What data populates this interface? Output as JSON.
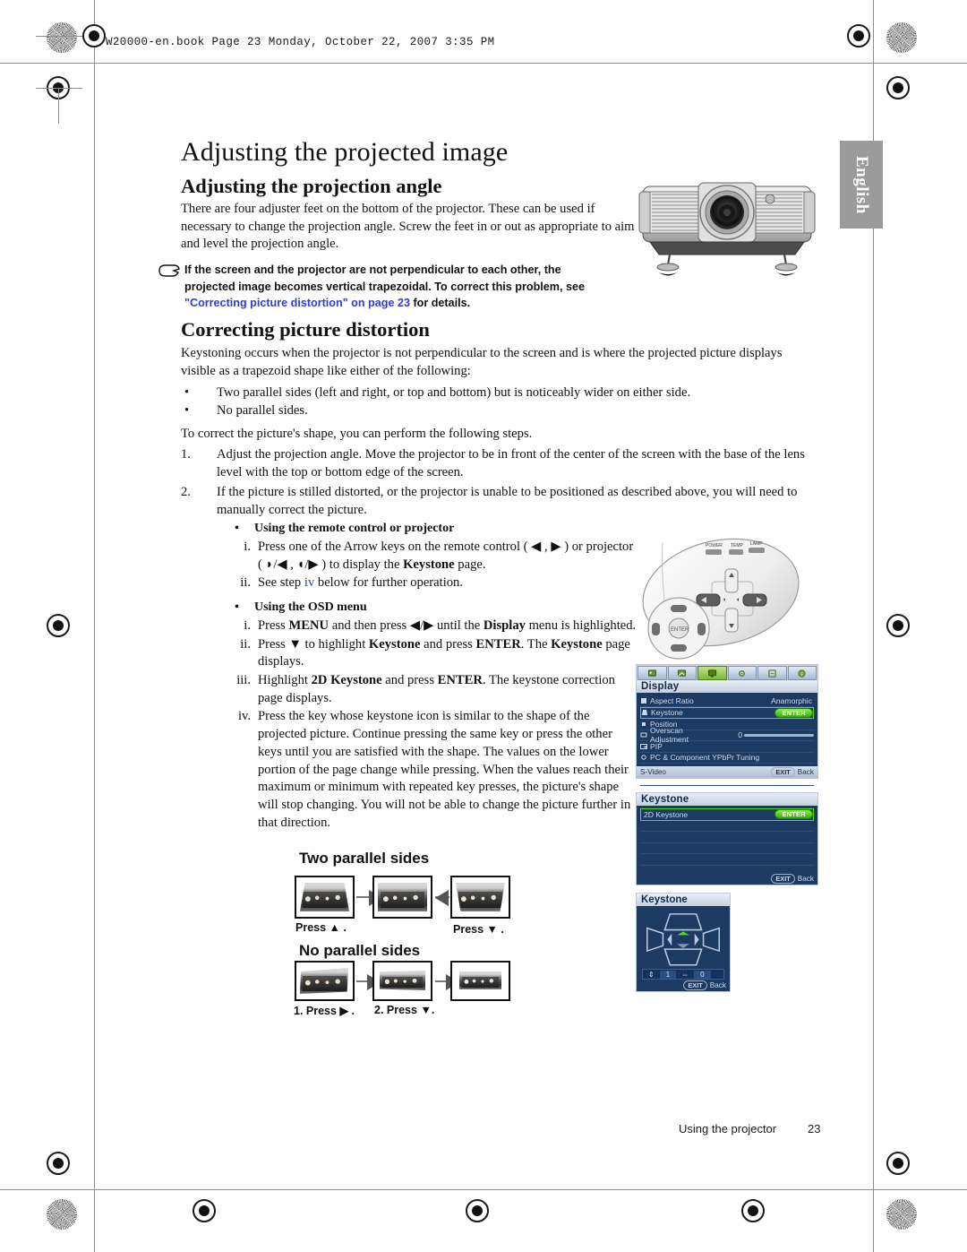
{
  "running_header": "W20000-en.book  Page 23  Monday, October 22, 2007  3:35 PM",
  "language_tab": "English",
  "headings": {
    "h1": "Adjusting the projected image",
    "h2_angle": "Adjusting the projection angle",
    "h2_distortion": "Correcting picture distortion"
  },
  "paragraphs": {
    "angle_intro": "There are four adjuster feet on the bottom of the projector. These can be used if necessary to change the projection angle. Screw the feet in or out as appropriate to aim and level the projection angle.",
    "keystoning_intro": "Keystoning occurs when the projector is not perpendicular to the screen and is where the projected picture displays visible as a trapezoid shape like either of the following:",
    "correct_shape": "To correct the picture's shape, you can perform the following steps."
  },
  "note": {
    "icon": "pointing-hand-icon",
    "line1": "If the screen and the projector are not perpendicular to each other, the",
    "line2": "projected image becomes vertical trapezoidal. To correct this problem, see",
    "link": "\"Correcting picture distortion\" on page 23",
    "line3_tail": " for details.",
    "link_color": "#2b3fd6"
  },
  "bullets": [
    "Two parallel sides (left and right, or top and bottom) but is noticeably wider on either side.",
    "No parallel sides."
  ],
  "steps": [
    {
      "num": "1.",
      "text": "Adjust the projection angle. Move the projector to be in front of the center of the screen with the base of the lens level with the top or bottom edge of the screen."
    },
    {
      "num": "2.",
      "text": "If the picture is stilled distorted, or the projector is unable to be positioned as described above, you will need to manually correct the picture."
    }
  ],
  "remote_block": {
    "heading": "Using the remote control or projector",
    "items": [
      {
        "num": "i.",
        "parts": [
          "Press one of the Arrow keys on the remote control ( ◀ , ▶ ) or projector ( ◗/◀ , ◖/▶ ) to display the ",
          "Keystone",
          " page."
        ]
      },
      {
        "num": "ii.",
        "parts": [
          "See step ",
          "iv",
          " below for further operation."
        ]
      }
    ]
  },
  "osd_block": {
    "heading": "Using the OSD menu",
    "items": [
      {
        "num": "i.",
        "text_a": "Press ",
        "bold_a": "MENU",
        "text_b": " and then press ◀/▶ until the ",
        "bold_b": "Display",
        "text_c": " menu is highlighted."
      },
      {
        "num": "ii.",
        "text_a": "Press ▼ to highlight ",
        "bold_a": "Keystone",
        "text_b": " and press ",
        "bold_b": "ENTER",
        "text_c": ". The ",
        "bold_c": "Keystone",
        "text_d": " page displays."
      },
      {
        "num": "iii.",
        "text_a": "Highlight ",
        "bold_a": "2D Keystone",
        "text_b": " and press ",
        "bold_b": "ENTER",
        "text_c": ". The keystone correction page displays."
      },
      {
        "num": "iv.",
        "text_a": "Press the key whose keystone icon is similar to the shape of the projected picture. Continue pressing the same key or press the other keys until you are satisfied with the shape.",
        "text_b": "The values on the lower portion of the page change while pressing. When the values reach their maximum or minimum with repeated key presses, the picture's shape will stop changing. You will not be able to change the picture further in that direction."
      }
    ]
  },
  "illustrations": {
    "two_parallel": {
      "title": "Two parallel sides",
      "left_label_a": "Press ",
      "left_label_b": " .",
      "left_glyph": "▲",
      "right_label_a": "Press ",
      "right_label_b": " .",
      "right_glyph": "▼"
    },
    "no_parallel": {
      "title": "No parallel sides",
      "label_1a": "1. Press ",
      "label_1glyph": "▶",
      "label_1b": " .",
      "label_2a": "2. Press ",
      "label_2glyph": "▼",
      "label_2b": "."
    }
  },
  "osd_display": {
    "panel_title": "Display",
    "tabs": [
      "picture-basic-icon",
      "picture-advanced-icon",
      "display-icon",
      "system-setup-basic-icon",
      "system-setup-advanced-icon",
      "information-icon"
    ],
    "active_tab_index": 2,
    "rows": [
      {
        "icon": "aspect-ratio-icon",
        "label": "Aspect Ratio",
        "value": "Anamorphic",
        "selected": false
      },
      {
        "icon": "keystone-icon",
        "label": "Keystone",
        "value": "ENTER",
        "selected": true
      },
      {
        "icon": "position-icon",
        "label": "Position",
        "value": "",
        "selected": false
      },
      {
        "icon": "overscan-icon",
        "label": "Overscan Adjustment",
        "value": "0",
        "selected": false
      },
      {
        "icon": "pip-icon",
        "label": "PIP",
        "value": "",
        "selected": false
      },
      {
        "icon": "ypbpr-icon",
        "label": "PC & Component YPbPr Tuning",
        "value": "",
        "selected": false
      }
    ],
    "footer_source": "S-Video",
    "footer_exit": "EXIT",
    "footer_back": "Back"
  },
  "osd_keystone": {
    "panel_title": "Keystone",
    "rows": [
      {
        "label": "2D Keystone",
        "value": "ENTER",
        "selected": true
      }
    ],
    "footer_exit": "EXIT",
    "footer_back": "Back"
  },
  "keystone_page": {
    "panel_title": "Keystone",
    "value_vertical": "1",
    "value_horizontal": "0",
    "footer_exit": "EXIT",
    "footer_back": "Back"
  },
  "footer": {
    "section": "Using the projector",
    "page": "23"
  },
  "colors": {
    "link": "#2b3fd6",
    "osd_bg": "#1d3a63",
    "osd_highlight": "#4fe017",
    "lang_tab_bg": "#9b9b9b"
  }
}
